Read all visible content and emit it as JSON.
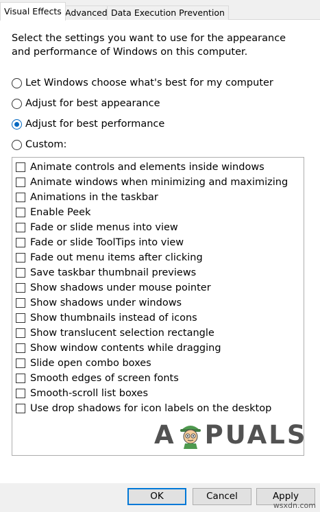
{
  "tabs": [
    "Visual Effects",
    "Advanced",
    "Data Execution Prevention"
  ],
  "description": "Select the settings you want to use for the appearance and performance of Windows on this computer.",
  "radios": [
    {
      "label": "Let Windows choose what's best for my computer",
      "checked": false
    },
    {
      "label": "Adjust for best appearance",
      "checked": false
    },
    {
      "label": "Adjust for best performance",
      "checked": true
    },
    {
      "label": "Custom:",
      "checked": false
    }
  ],
  "checkboxes": [
    "Animate controls and elements inside windows",
    "Animate windows when minimizing and maximizing",
    "Animations in the taskbar",
    "Enable Peek",
    "Fade or slide menus into view",
    "Fade or slide ToolTips into view",
    "Fade out menu items after clicking",
    "Save taskbar thumbnail previews",
    "Show shadows under mouse pointer",
    "Show shadows under windows",
    "Show thumbnails instead of icons",
    "Show translucent selection rectangle",
    "Show window contents while dragging",
    "Slide open combo boxes",
    "Smooth edges of screen fonts",
    "Smooth-scroll list boxes",
    "Use drop shadows for icon labels on the desktop"
  ],
  "buttons": {
    "ok": "OK",
    "cancel": "Cancel",
    "apply": "Apply"
  },
  "watermark": {
    "left": "A",
    "right": "PUALS"
  },
  "source_mark": "wsxdn.com",
  "colors": {
    "accent": "#0067c0",
    "default_button_border": "#0078d7"
  }
}
